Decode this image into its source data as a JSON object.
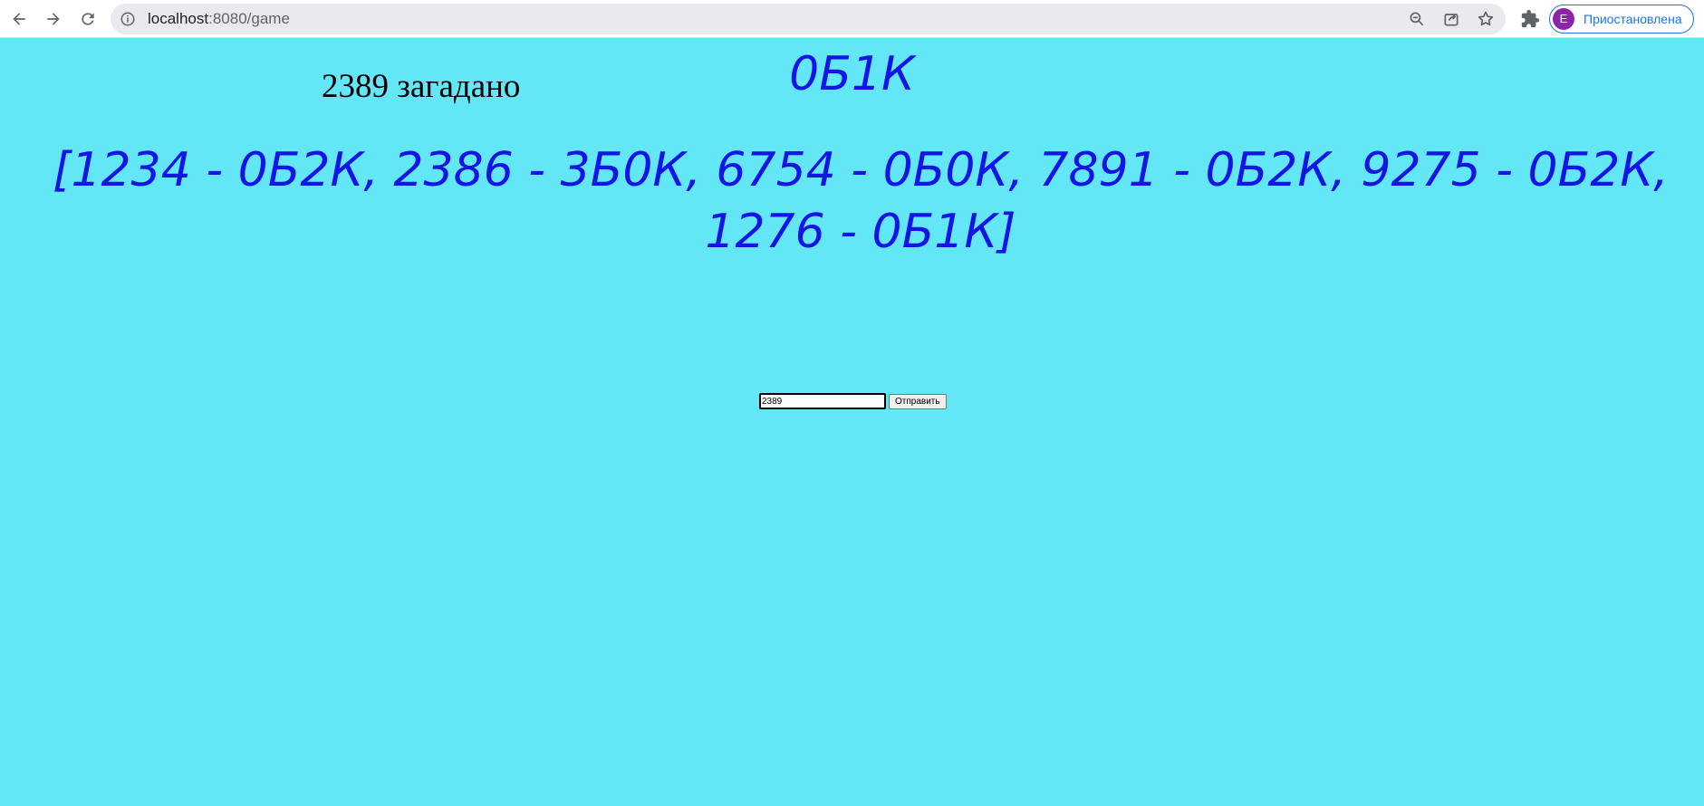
{
  "browser": {
    "url_host": "localhost",
    "url_path": ":8080/game",
    "profile_initial": "E",
    "profile_label": "Приостановлена",
    "colors": {
      "profile_avatar": "#8e24aa",
      "profile_accent": "#1a73e8"
    },
    "icons": [
      "back-arrow-icon",
      "forward-arrow-icon",
      "reload-icon",
      "site-info-icon",
      "zoom-icon",
      "share-icon",
      "bookmark-star-icon",
      "extensions-puzzle-icon"
    ]
  },
  "game": {
    "secret_text": "2389 загадано",
    "last_result": "0Б1К",
    "history_text": "[1234 - 0Б2К, 2386 - 3Б0К, 6754 - 0Б0К, 7891 - 0Б2К, 9275 - 0Б2К, 1276 - 0Б1К]",
    "guess_value": "2389",
    "submit_label": "Отправить",
    "colors": {
      "background": "#63e6f6",
      "result_text": "#1414e6"
    }
  }
}
